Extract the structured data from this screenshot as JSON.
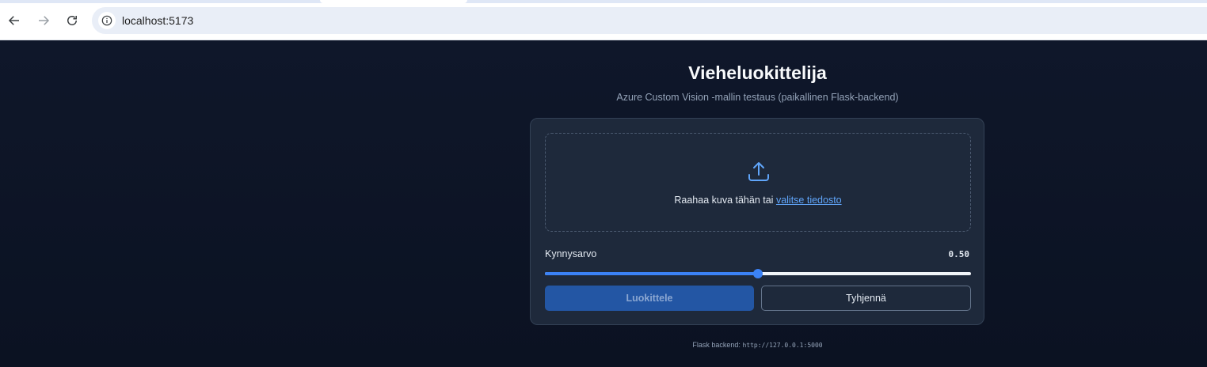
{
  "browser": {
    "url": "localhost:5173",
    "icons": {
      "back": "arrow-left-icon",
      "forward": "arrow-right-icon",
      "reload": "reload-icon",
      "site_info": "info-icon"
    }
  },
  "app": {
    "title": "Vieheluokittelija",
    "subtitle": "Azure Custom Vision -mallin testaus (paikallinen Flask-backend)"
  },
  "dropzone": {
    "icon": "upload-icon",
    "text": "Raahaa kuva tähän tai",
    "link": "valitse tiedosto"
  },
  "threshold": {
    "label": "Kynnysarvo",
    "value_text": "0.50",
    "value": 0.5
  },
  "buttons": {
    "classify": "Luokittele",
    "clear": "Tyhjennä"
  },
  "footer": {
    "label": "Flask backend:",
    "url": "http://127.0.0.1:5000"
  },
  "colors": {
    "accent": "#3b82f6",
    "link": "#60a5fa",
    "background": "#0f172a",
    "card": "#1e293b"
  }
}
